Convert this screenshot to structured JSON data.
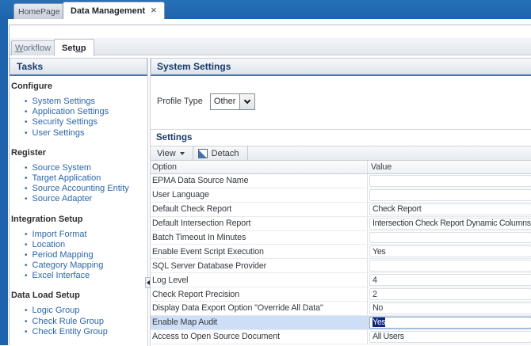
{
  "window_tabs": {
    "home_label": "HomePage",
    "active_label": "Data Management",
    "close_icon": "×"
  },
  "module_tabs": {
    "workflow": {
      "pre": "",
      "mn": "W",
      "post": "orkflow"
    },
    "setup": {
      "pre": "Set",
      "mn": "u",
      "post": "p"
    }
  },
  "sidebar": {
    "title": "Tasks",
    "sections": [
      {
        "title": "Configure",
        "items": [
          "System Settings",
          "Application Settings",
          "Security Settings",
          "User Settings"
        ]
      },
      {
        "title": "Register",
        "items": [
          "Source System",
          "Target Application",
          "Source Accounting Entity",
          "Source Adapter"
        ]
      },
      {
        "title": "Integration Setup",
        "items": [
          "Import Format",
          "Location",
          "Period Mapping",
          "Category Mapping",
          "Excel Interface"
        ]
      },
      {
        "title": "Data Load Setup",
        "items": [
          "Logic Group",
          "Check Rule Group",
          "Check Entity Group"
        ]
      }
    ]
  },
  "main": {
    "title": "System Settings",
    "profile_type_label": "Profile Type",
    "profile_type_value": "Other",
    "settings": {
      "title": "Settings",
      "toolbar": {
        "view_label": "View",
        "detach_label": "Detach"
      },
      "table": {
        "columns": [
          "Option",
          "Value"
        ],
        "rows": [
          {
            "option": "EPMA Data Source Name",
            "value": ""
          },
          {
            "option": "User Language",
            "value": ""
          },
          {
            "option": "Default Check Report",
            "value": "Check Report"
          },
          {
            "option": "Default Intersection Report",
            "value": "Intersection Check Report Dynamic Columns"
          },
          {
            "option": "Batch Timeout In Minutes",
            "value": ""
          },
          {
            "option": "Enable Event Script Execution",
            "value": "Yes"
          },
          {
            "option": "SQL Server Database Provider",
            "value": ""
          },
          {
            "option": "Log Level",
            "value": "4"
          },
          {
            "option": "Check Report Precision",
            "value": "2"
          },
          {
            "option": "Display Data Export Option \"Override All Data\"",
            "value": "No"
          },
          {
            "option": "Enable Map Audit",
            "value": "Yes",
            "highlighted": true
          },
          {
            "option": "Access to Open Source Document",
            "value": "All Users"
          }
        ]
      }
    }
  }
}
